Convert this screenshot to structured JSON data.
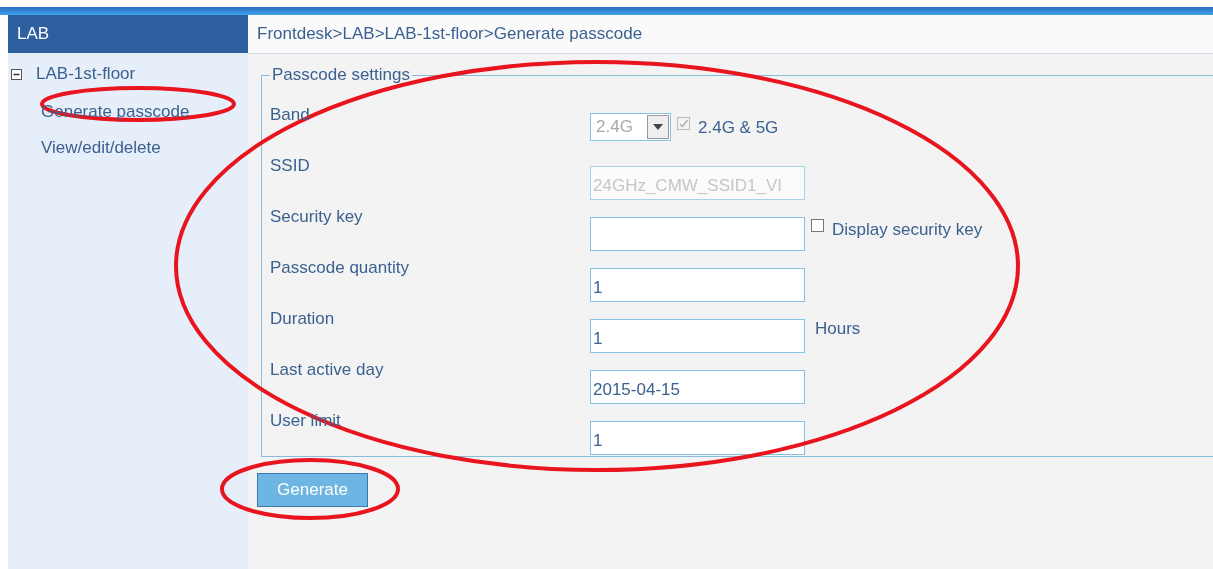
{
  "sidebar": {
    "title": "LAB",
    "tree": [
      {
        "label": "LAB-1st-floor",
        "expanded": true,
        "children": [
          {
            "label": "Generate passcode"
          },
          {
            "label": "View/edit/delete"
          }
        ]
      }
    ]
  },
  "breadcrumb": "Frontdesk>LAB>LAB-1st-floor>Generate passcode",
  "settings": {
    "legend": "Passcode settings",
    "fields": [
      {
        "label": "Band",
        "kind": "select",
        "value": "2.4G",
        "disabled": true,
        "checkbox": {
          "label": "2.4G & 5G",
          "checked": true,
          "disabled": true
        }
      },
      {
        "label": "SSID",
        "kind": "text",
        "value": "24GHz_CMW_SSID1_VI",
        "disabled": true
      },
      {
        "label": "Security key",
        "kind": "text",
        "disabled": false,
        "checkbox": {
          "label": "Display security key",
          "checked": false,
          "disabled": false
        }
      },
      {
        "label": "Passcode quantity",
        "kind": "text",
        "value": "1",
        "disabled": false
      },
      {
        "label": "Duration",
        "kind": "text",
        "value": "1",
        "disabled": false,
        "suffix": "Hours"
      },
      {
        "label": "Last active day",
        "kind": "text",
        "value": "2015-04-15",
        "disabled": false
      },
      {
        "label": "User limit",
        "kind": "text",
        "value": "1",
        "disabled": false
      }
    ]
  },
  "generate_button": "Generate"
}
